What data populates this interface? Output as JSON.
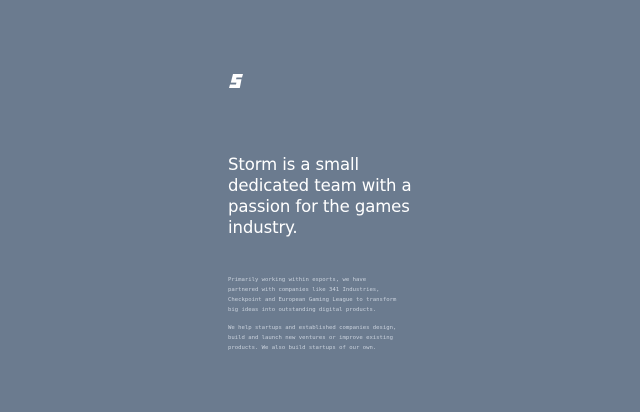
{
  "brand": {
    "logo_icon": "storm-s-logo-icon",
    "logo_color": "#ffffff"
  },
  "colors": {
    "background": "#6b7b8f",
    "headline": "#ffffff",
    "body": "#c9d1dc"
  },
  "hero": {
    "headline_line_1": "Storm is a small",
    "headline_line_2": "dedicated team with a",
    "headline_line_3": "passion for the games",
    "headline_line_4": "industry."
  },
  "about": {
    "paragraph_1_line_1": "Primarily working within esports, we have",
    "paragraph_1_line_2": "partnered with companies like 341 Industries,",
    "paragraph_1_line_3": "Checkpoint and European Gaming League to transform",
    "paragraph_1_line_4": "big ideas into outstanding digital products.",
    "paragraph_2_line_1": "We help startups and established companies design,",
    "paragraph_2_line_2": "build and launch new ventures or improve existing",
    "paragraph_2_line_3": "products. We also build startups of our own."
  }
}
